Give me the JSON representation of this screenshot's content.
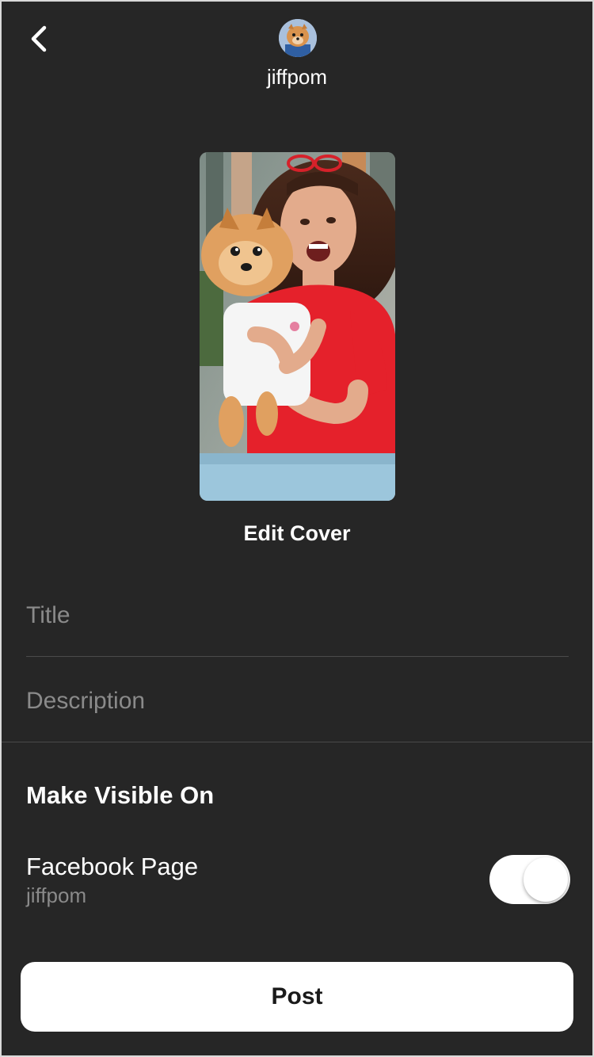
{
  "header": {
    "back_icon": "chevron-left-icon",
    "avatar_icon": "pomeranian-avatar",
    "username": "jiffpom"
  },
  "cover": {
    "image": "woman-holding-pomeranian-photo",
    "edit_label": "Edit Cover"
  },
  "form": {
    "title_placeholder": "Title",
    "title_value": "",
    "description_placeholder": "Description",
    "description_value": ""
  },
  "visibility": {
    "heading": "Make Visible On",
    "facebook_page_label": "Facebook Page",
    "facebook_page_name": "jiffpom",
    "facebook_toggle_on": true
  },
  "actions": {
    "post_label": "Post"
  },
  "colors": {
    "background": "#262626",
    "text_primary": "#ffffff",
    "text_secondary": "#8a8a8a",
    "button_bg": "#ffffff"
  }
}
